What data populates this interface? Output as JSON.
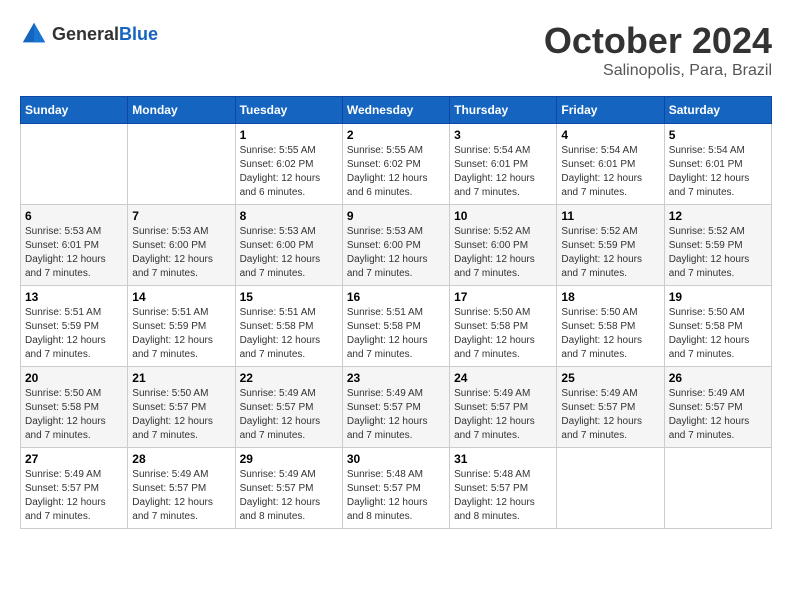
{
  "header": {
    "logo_general": "General",
    "logo_blue": "Blue",
    "month": "October 2024",
    "location": "Salinopolis, Para, Brazil"
  },
  "weekdays": [
    "Sunday",
    "Monday",
    "Tuesday",
    "Wednesday",
    "Thursday",
    "Friday",
    "Saturday"
  ],
  "weeks": [
    [
      {
        "day": "",
        "info": ""
      },
      {
        "day": "",
        "info": ""
      },
      {
        "day": "1",
        "info": "Sunrise: 5:55 AM\nSunset: 6:02 PM\nDaylight: 12 hours and 6 minutes."
      },
      {
        "day": "2",
        "info": "Sunrise: 5:55 AM\nSunset: 6:02 PM\nDaylight: 12 hours and 6 minutes."
      },
      {
        "day": "3",
        "info": "Sunrise: 5:54 AM\nSunset: 6:01 PM\nDaylight: 12 hours and 7 minutes."
      },
      {
        "day": "4",
        "info": "Sunrise: 5:54 AM\nSunset: 6:01 PM\nDaylight: 12 hours and 7 minutes."
      },
      {
        "day": "5",
        "info": "Sunrise: 5:54 AM\nSunset: 6:01 PM\nDaylight: 12 hours and 7 minutes."
      }
    ],
    [
      {
        "day": "6",
        "info": "Sunrise: 5:53 AM\nSunset: 6:01 PM\nDaylight: 12 hours and 7 minutes."
      },
      {
        "day": "7",
        "info": "Sunrise: 5:53 AM\nSunset: 6:00 PM\nDaylight: 12 hours and 7 minutes."
      },
      {
        "day": "8",
        "info": "Sunrise: 5:53 AM\nSunset: 6:00 PM\nDaylight: 12 hours and 7 minutes."
      },
      {
        "day": "9",
        "info": "Sunrise: 5:53 AM\nSunset: 6:00 PM\nDaylight: 12 hours and 7 minutes."
      },
      {
        "day": "10",
        "info": "Sunrise: 5:52 AM\nSunset: 6:00 PM\nDaylight: 12 hours and 7 minutes."
      },
      {
        "day": "11",
        "info": "Sunrise: 5:52 AM\nSunset: 5:59 PM\nDaylight: 12 hours and 7 minutes."
      },
      {
        "day": "12",
        "info": "Sunrise: 5:52 AM\nSunset: 5:59 PM\nDaylight: 12 hours and 7 minutes."
      }
    ],
    [
      {
        "day": "13",
        "info": "Sunrise: 5:51 AM\nSunset: 5:59 PM\nDaylight: 12 hours and 7 minutes."
      },
      {
        "day": "14",
        "info": "Sunrise: 5:51 AM\nSunset: 5:59 PM\nDaylight: 12 hours and 7 minutes."
      },
      {
        "day": "15",
        "info": "Sunrise: 5:51 AM\nSunset: 5:58 PM\nDaylight: 12 hours and 7 minutes."
      },
      {
        "day": "16",
        "info": "Sunrise: 5:51 AM\nSunset: 5:58 PM\nDaylight: 12 hours and 7 minutes."
      },
      {
        "day": "17",
        "info": "Sunrise: 5:50 AM\nSunset: 5:58 PM\nDaylight: 12 hours and 7 minutes."
      },
      {
        "day": "18",
        "info": "Sunrise: 5:50 AM\nSunset: 5:58 PM\nDaylight: 12 hours and 7 minutes."
      },
      {
        "day": "19",
        "info": "Sunrise: 5:50 AM\nSunset: 5:58 PM\nDaylight: 12 hours and 7 minutes."
      }
    ],
    [
      {
        "day": "20",
        "info": "Sunrise: 5:50 AM\nSunset: 5:58 PM\nDaylight: 12 hours and 7 minutes."
      },
      {
        "day": "21",
        "info": "Sunrise: 5:50 AM\nSunset: 5:57 PM\nDaylight: 12 hours and 7 minutes."
      },
      {
        "day": "22",
        "info": "Sunrise: 5:49 AM\nSunset: 5:57 PM\nDaylight: 12 hours and 7 minutes."
      },
      {
        "day": "23",
        "info": "Sunrise: 5:49 AM\nSunset: 5:57 PM\nDaylight: 12 hours and 7 minutes."
      },
      {
        "day": "24",
        "info": "Sunrise: 5:49 AM\nSunset: 5:57 PM\nDaylight: 12 hours and 7 minutes."
      },
      {
        "day": "25",
        "info": "Sunrise: 5:49 AM\nSunset: 5:57 PM\nDaylight: 12 hours and 7 minutes."
      },
      {
        "day": "26",
        "info": "Sunrise: 5:49 AM\nSunset: 5:57 PM\nDaylight: 12 hours and 7 minutes."
      }
    ],
    [
      {
        "day": "27",
        "info": "Sunrise: 5:49 AM\nSunset: 5:57 PM\nDaylight: 12 hours and 7 minutes."
      },
      {
        "day": "28",
        "info": "Sunrise: 5:49 AM\nSunset: 5:57 PM\nDaylight: 12 hours and 7 minutes."
      },
      {
        "day": "29",
        "info": "Sunrise: 5:49 AM\nSunset: 5:57 PM\nDaylight: 12 hours and 8 minutes."
      },
      {
        "day": "30",
        "info": "Sunrise: 5:48 AM\nSunset: 5:57 PM\nDaylight: 12 hours and 8 minutes."
      },
      {
        "day": "31",
        "info": "Sunrise: 5:48 AM\nSunset: 5:57 PM\nDaylight: 12 hours and 8 minutes."
      },
      {
        "day": "",
        "info": ""
      },
      {
        "day": "",
        "info": ""
      }
    ]
  ]
}
